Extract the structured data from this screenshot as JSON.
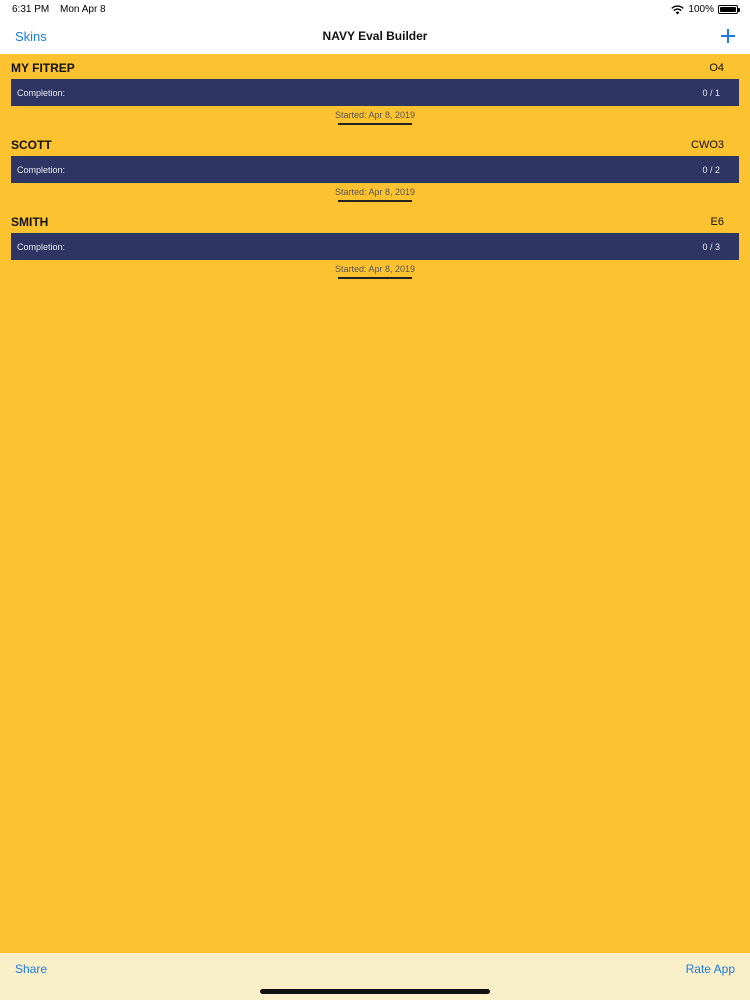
{
  "status_bar": {
    "time": "6:31 PM",
    "date": "Mon Apr 8",
    "battery": "100%",
    "icons": [
      "wifi-icon",
      "battery-icon"
    ]
  },
  "nav": {
    "left_label": "Skins",
    "title": "NAVY Eval Builder",
    "add_icon": "plus-icon"
  },
  "evals": [
    {
      "name": "MY FITREP",
      "rank": "O4",
      "completion_label": "Completion:",
      "count": "0 / 1",
      "started": "Started: Apr 8, 2019"
    },
    {
      "name": "SCOTT",
      "rank": "CWO3",
      "completion_label": "Completion:",
      "count": "0 / 2",
      "started": "Started: Apr 8, 2019"
    },
    {
      "name": "SMITH",
      "rank": "E6",
      "completion_label": "Completion:",
      "count": "0 / 3",
      "started": "Started: Apr 8, 2019"
    }
  ],
  "bottom": {
    "share_label": "Share",
    "rate_label": "Rate App"
  },
  "colors": {
    "background": "#fdc22f",
    "bar": "#2e3562",
    "accent": "#1a7de0"
  }
}
